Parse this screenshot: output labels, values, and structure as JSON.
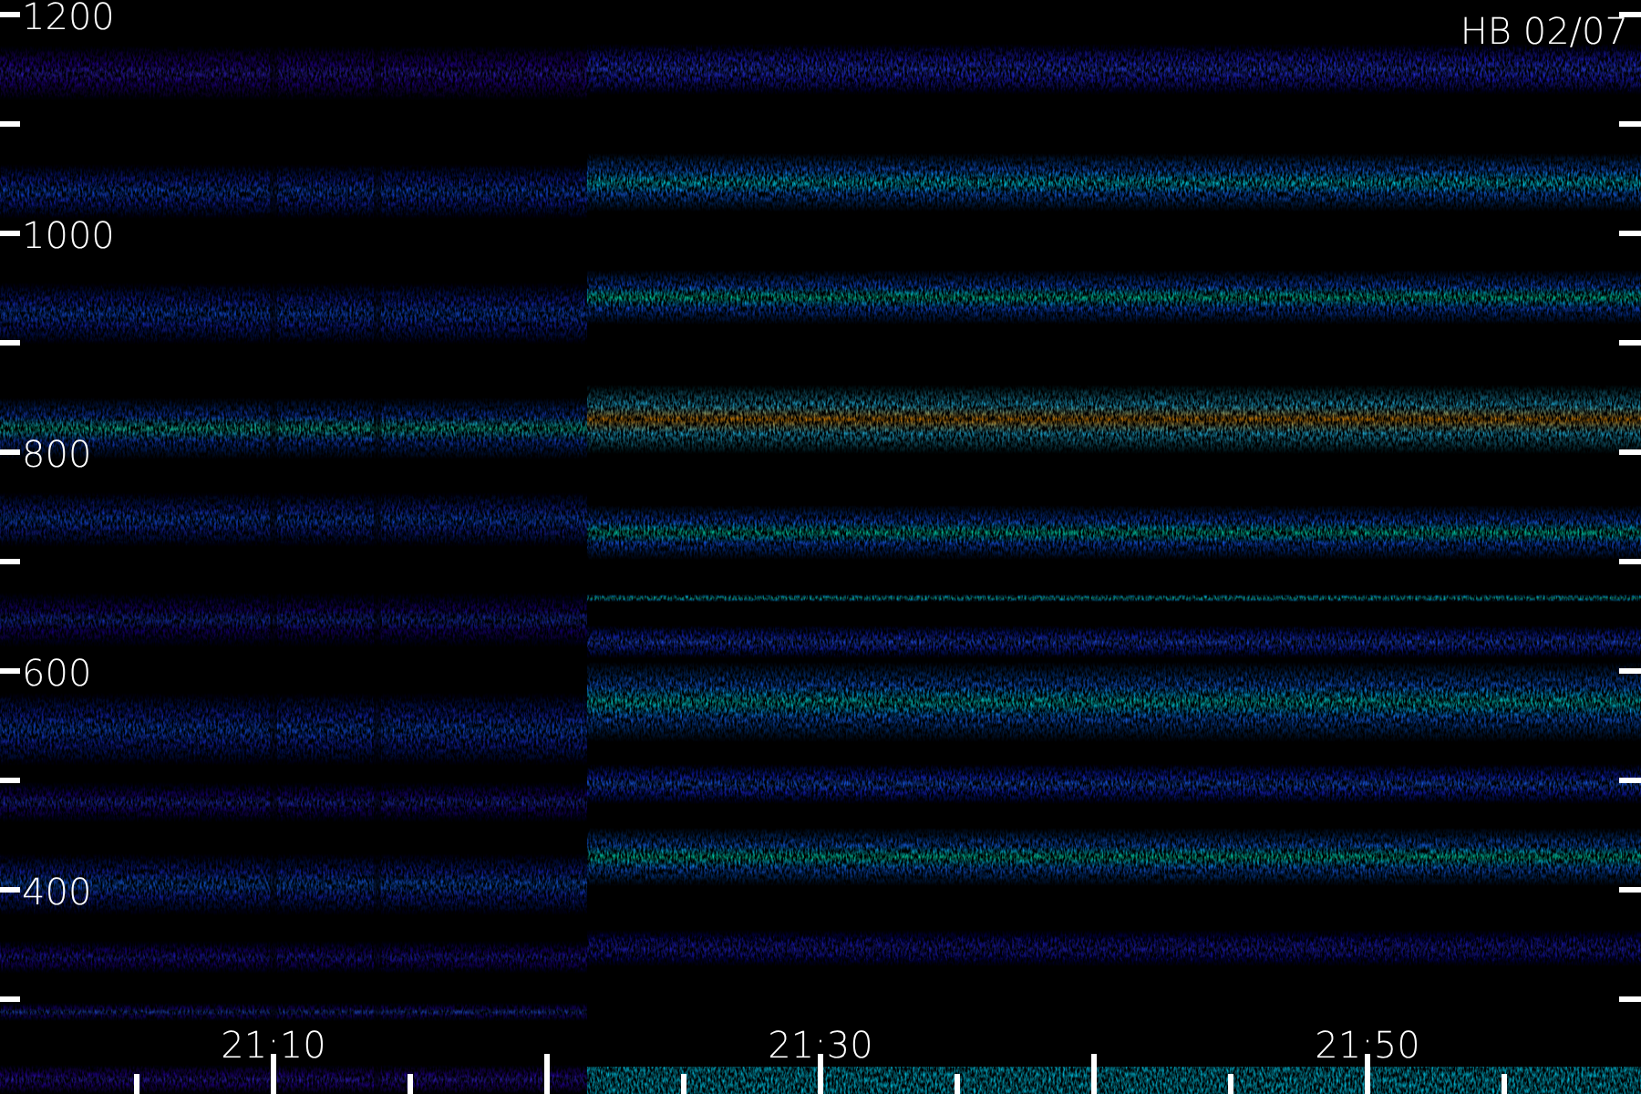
{
  "title": "HB 02/07",
  "y_axis": {
    "labels": [
      "1200",
      "1000",
      "800",
      "600",
      "400"
    ]
  },
  "x_axis": {
    "labels": [
      "21:10",
      "21:30",
      "21:50"
    ]
  }
}
